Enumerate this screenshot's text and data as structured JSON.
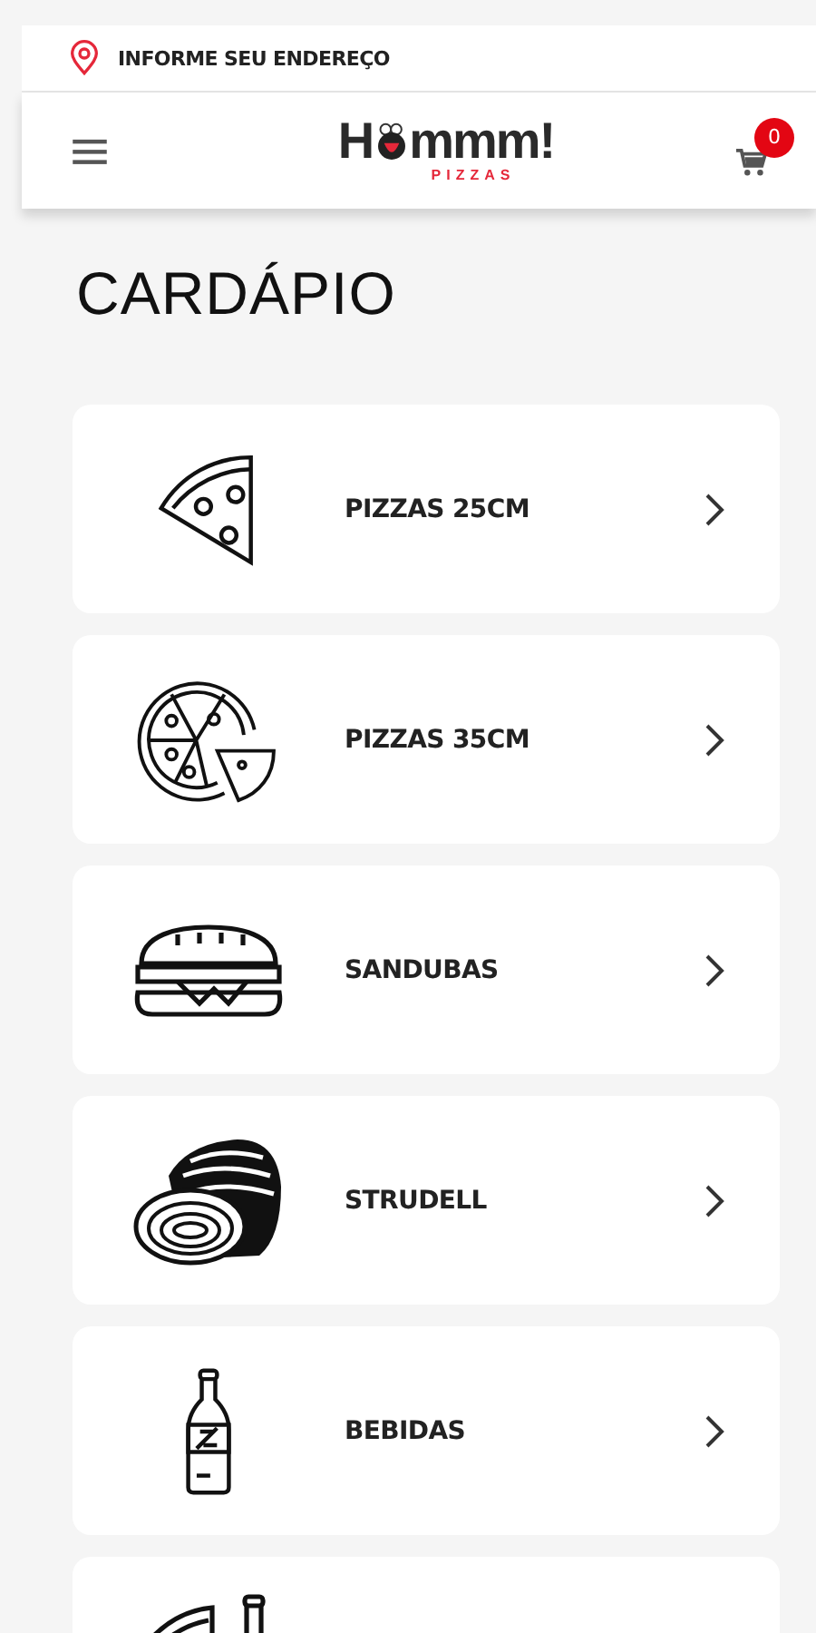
{
  "address_bar": {
    "label": "INFORME SEU ENDEREÇO"
  },
  "header": {
    "logo": {
      "before": "H",
      "after": "mmm!",
      "tagline": "PIZZAS"
    },
    "cart_count": "0"
  },
  "page_title": "CARDÁPIO",
  "categories": [
    {
      "kind": "pizza-slice",
      "label": "PIZZAS 25CM"
    },
    {
      "kind": "pizza-whole",
      "label": "PIZZAS 35CM"
    },
    {
      "kind": "sandwich",
      "label": "SANDUBAS"
    },
    {
      "kind": "strudel",
      "label": "STRUDELL"
    },
    {
      "kind": "bottle",
      "label": "BEBIDAS"
    },
    {
      "kind": "combo"
    }
  ]
}
